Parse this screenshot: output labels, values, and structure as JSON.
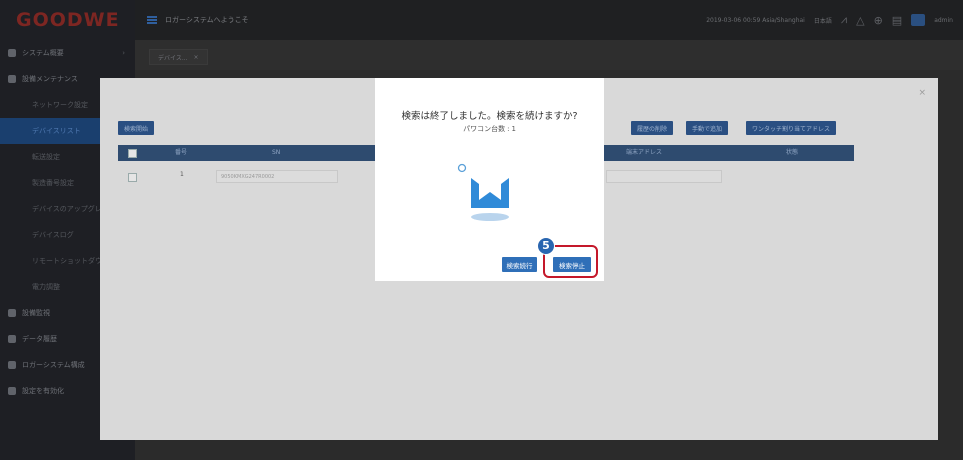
{
  "brand": {
    "logo": "GOODWE"
  },
  "header": {
    "welcome": "ロガーシステムへようこそ",
    "datetime": "2019-03-06 00:59 Asia/Shanghai",
    "language": "日本語",
    "user": "admin"
  },
  "sidebar": {
    "items": [
      {
        "label": "システム概要"
      },
      {
        "label": "設備メンテナンス"
      },
      {
        "label": "ネットワーク設定"
      },
      {
        "label": "デバイスリスト"
      },
      {
        "label": "転送設定"
      },
      {
        "label": "製造番号設定"
      },
      {
        "label": "デバイスのアップグレード"
      },
      {
        "label": "デバイスログ"
      },
      {
        "label": "リモートショットダウン"
      },
      {
        "label": "電力調整"
      },
      {
        "label": "設備監視"
      },
      {
        "label": "データ履歴"
      },
      {
        "label": "ロガーシステム構成"
      },
      {
        "label": "設定を有効化"
      }
    ]
  },
  "tabs": {
    "active": "デバイス..."
  },
  "toolbar": {
    "search_start": "検索開始",
    "delete_history": "履歴の削除",
    "manual_add": "手動で追加",
    "one_touch_assign": "ワンタッチ割り当てアドレス"
  },
  "table": {
    "headers": {
      "no": "番号",
      "sn": "SN",
      "address": "端末アドレス",
      "status": "状態"
    },
    "rows": [
      {
        "no": "1",
        "sn": "9050KMXG247R0002"
      }
    ]
  },
  "modal": {
    "title": "検索は終了しました。検索を続けますか?",
    "count_label": "パワコン台数",
    "count_sep": ":",
    "count_value": "1",
    "continue_button": "検索続行",
    "stop_button": "検索停止"
  },
  "annotation": {
    "step": "5"
  },
  "colors": {
    "accent": "#2f6fb8",
    "highlight": "#c4182a",
    "brand": "#7d2622"
  }
}
